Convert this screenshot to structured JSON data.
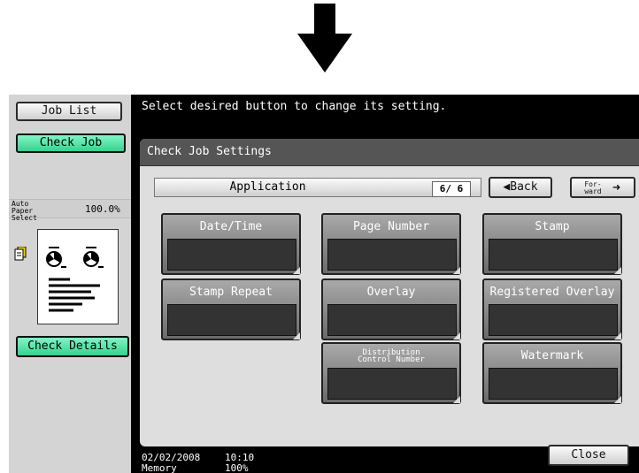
{
  "sidebar": {
    "job_list_label": "Job List",
    "check_job_label": "Check Job",
    "paper_select_label": "Auto Paper Select",
    "zoom": "100.0%",
    "check_details_label": "Check Details"
  },
  "message": "Select desired button to change its setting.",
  "panel": {
    "title": "Check Job Settings",
    "section_label": "Application",
    "page_indicator": "6/ 6",
    "back_label": "Back",
    "forward_label": "For-\nward"
  },
  "functions": [
    {
      "label": "Date/Time"
    },
    {
      "label": "Page Number"
    },
    {
      "label": "Stamp"
    },
    {
      "label": "Stamp Repeat"
    },
    {
      "label": "Overlay"
    },
    {
      "label": "Registered Overlay"
    },
    {
      "label": "Distribution\nControl Number"
    },
    {
      "label": "Watermark"
    }
  ],
  "status": {
    "date": "02/02/2008",
    "time": "10:10",
    "memory_label": "Memory",
    "memory_value": "100%"
  },
  "close_label": "Close",
  "colors": {
    "accent_green": "#38d08f",
    "function_button": "#8a8a8a"
  }
}
